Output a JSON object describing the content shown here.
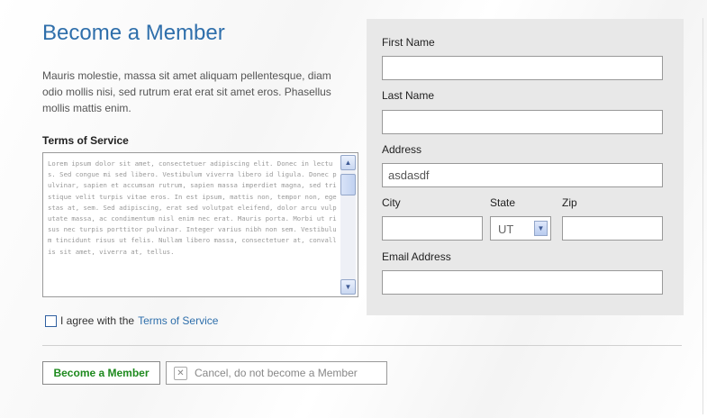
{
  "page": {
    "title": "Become a Member",
    "intro": "Mauris molestie, massa sit amet aliquam pellentesque, diam odio mollis nisi, sed rutrum erat erat sit amet eros. Phasellus mollis mattis enim."
  },
  "terms": {
    "heading": "Terms of Service",
    "text": "Lorem ipsum dolor sit amet, consectetuer adipiscing elit. Donec in lectus. Sed congue mi sed libero. Vestibulum viverra libero id ligula. Donec pulvinar, sapien et accumsan rutrum, sapien massa imperdiet magna, sed tristique velit turpis vitae eros. In est ipsum, mattis non, tempor non, egestas at, sem. Sed adipiscing, erat sed volutpat eleifend, dolor arcu vulputate massa, ac condimentum nisl enim nec erat. Mauris porta. Morbi ut risus nec turpis porttitor pulvinar. Integer varius nibh non sem. Vestibulum tincidunt risus ut felis. Nullam libero massa, consectetuer at, convallis sit amet, viverra at, tellus."
  },
  "agree": {
    "label": "I agree with the",
    "link": "Terms of Service",
    "checked": false
  },
  "form": {
    "first_name_label": "First Name",
    "first_name_value": "",
    "last_name_label": "Last Name",
    "last_name_value": "",
    "address_label": "Address",
    "address_value": "asdasdf",
    "city_label": "City",
    "city_value": "",
    "state_label": "State",
    "state_value": "UT",
    "zip_label": "Zip",
    "zip_value": "",
    "email_label": "Email Address",
    "email_value": ""
  },
  "buttons": {
    "submit": "Become a Member",
    "cancel": "Cancel, do not become a Member"
  },
  "colors": {
    "accent": "#2f6fab",
    "submit_text": "#1e8a1e",
    "panel_bg": "#e8e8e8"
  },
  "icons": {
    "scroll_up": "scroll-up-icon",
    "scroll_down": "scroll-down-icon",
    "cancel": "close-icon",
    "select": "chevron-down-icon"
  }
}
